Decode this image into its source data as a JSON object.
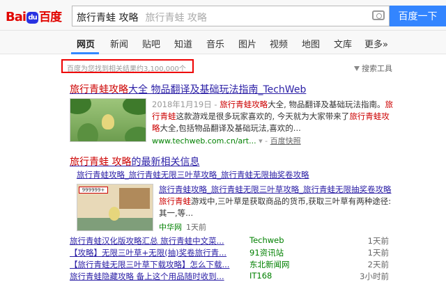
{
  "header": {
    "logo_bai": "Bai",
    "logo_paw": "du",
    "logo_du": "百度",
    "query": "旅行青蛙 攻略",
    "query_ghost": "旅行青蛙 攻略",
    "search_button": "百度一下"
  },
  "tabs": [
    "网页",
    "新闻",
    "贴吧",
    "知道",
    "音乐",
    "图片",
    "视频",
    "地图",
    "文库",
    "更多»"
  ],
  "results_count": "百度为您找到相关结果约3,100,000个",
  "search_tools": "搜索工具",
  "result1": {
    "title_a": "旅行青蛙攻略",
    "title_b": "大全 物品翻译及基础玩法指南_TechWeb",
    "date": "2018年1月19日 - ",
    "snip1": "旅行青蛙攻略",
    "snip2": "大全, 物品翻译及基础玩法指南。",
    "snip3": "旅行青蛙",
    "snip4": "这款游戏是很多玩家喜欢的, 今天就为大家带来了",
    "snip5": "旅行青蛙攻略",
    "snip6": "大全,包括物品翻译及基础玩法,喜欢的...",
    "url": "www.techweb.com.cn/art...",
    "url_arrow": " ▾ - ",
    "snapshot": "百度快照"
  },
  "news": {
    "title_a": "旅行青蛙 攻略",
    "title_b": "的最新相关信息",
    "sub": "旅行青蛙攻略_旅行青蛙无限三叶草攻略_旅行青蛙无限抽奖卷攻略",
    "thumb_badge": "999999+",
    "snip_a": "旅行青蛙攻略",
    "snip_b": "_旅行青蛙无限三叶草",
    "snip_c": "攻略",
    "snip_d": "_旅行青蛙",
    "snip_e": "无限抽奖卷",
    "snip_f": "攻略",
    "snip_g": "旅行青蛙",
    "snip_h": "游戏中,三叶草是获取商品的货币,获取三叶草有两种途径:其一,等...",
    "source": "中华网",
    "time": "1天前",
    "rows": [
      {
        "title": "旅行青蛙汉化版攻略汇总 旅行青蛙中文菜...",
        "src": "Techweb",
        "time": "1天前"
      },
      {
        "title": "【攻略】无限三叶草+无限(抽)奖卷旅行青...",
        "src": "91资讯站",
        "time": "1天前"
      },
      {
        "title": "【旅行青蛙无限三叶草下载攻略】怎么下载...",
        "src": "东北新闻网",
        "time": "2天前"
      },
      {
        "title": "旅行青蛙隐藏攻略 备上这个用品随时收到...",
        "src": "IT168",
        "time": "3小时前"
      }
    ]
  }
}
